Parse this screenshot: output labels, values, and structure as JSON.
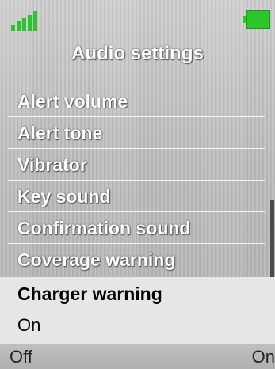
{
  "status_bar": {
    "signal_icon": "signal-bars-icon",
    "battery_icon": "battery-icon",
    "indicator_color": "#2bc62b"
  },
  "title": "Audio settings",
  "menu": {
    "items": [
      {
        "label": "Alert volume"
      },
      {
        "label": "Alert tone"
      },
      {
        "label": "Vibrator"
      },
      {
        "label": "Key sound"
      },
      {
        "label": "Confirmation sound"
      },
      {
        "label": "Coverage warning"
      }
    ],
    "selected": {
      "label": "Charger warning",
      "value": "On"
    }
  },
  "softkeys": {
    "left": "Off",
    "right": "On"
  }
}
